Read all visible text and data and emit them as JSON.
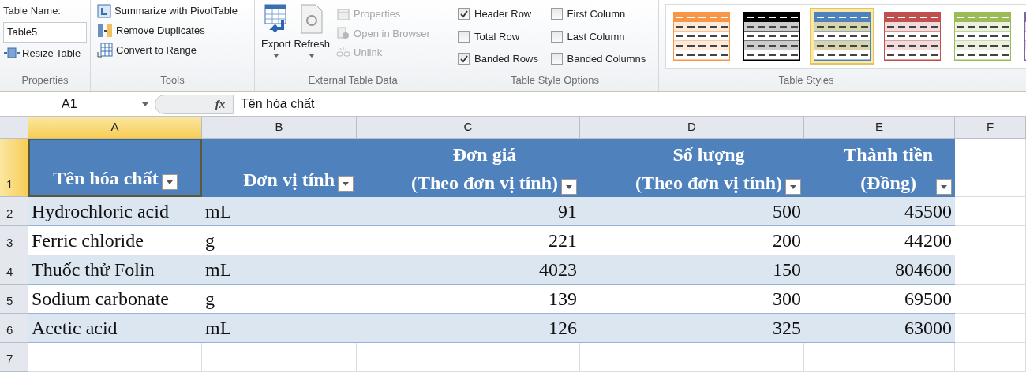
{
  "ribbon": {
    "groups": [
      {
        "kind": "properties",
        "label": "Properties",
        "table_name_label": "Table Name:",
        "table_name": "Table5",
        "resize": "Resize Table"
      },
      {
        "kind": "tools",
        "label": "Tools",
        "items": [
          {
            "label": "Summarize with PivotTable"
          },
          {
            "label": "Remove Duplicates"
          },
          {
            "label": "Convert to Range"
          }
        ]
      },
      {
        "kind": "external",
        "label": "External Table Data",
        "large": [
          {
            "label": "Export",
            "disabled": false
          },
          {
            "label": "Refresh",
            "disabled": false
          }
        ],
        "small": [
          {
            "label": "Properties",
            "disabled": true
          },
          {
            "label": "Open in Browser",
            "disabled": true
          },
          {
            "label": "Unlink",
            "disabled": true
          }
        ]
      },
      {
        "kind": "options",
        "label": "Table Style Options",
        "options": [
          {
            "label": "Header Row",
            "checked": true
          },
          {
            "label": "Total Row",
            "checked": false
          },
          {
            "label": "Banded Rows",
            "checked": true
          },
          {
            "label": "First Column",
            "checked": false
          },
          {
            "label": "Last Column",
            "checked": false
          },
          {
            "label": "Banded Columns",
            "checked": false
          }
        ]
      },
      {
        "kind": "styles",
        "label": "Table Styles",
        "styles": [
          {
            "color": "#f79646",
            "selected": false
          },
          {
            "color": "#000000",
            "selected": false
          },
          {
            "color": "#4f81bd",
            "selected": true
          },
          {
            "color": "#c0504d",
            "selected": false
          },
          {
            "color": "#9bbb59",
            "selected": false
          },
          {
            "color": "#8064a2",
            "selected": false
          }
        ]
      }
    ]
  },
  "formula_bar": {
    "name_box": "A1",
    "fx": "fx",
    "formula": "Tên hóa chất"
  },
  "sheet": {
    "columns": [
      {
        "label": "A",
        "selected": true
      },
      {
        "label": "B",
        "selected": false
      },
      {
        "label": "C",
        "selected": false
      },
      {
        "label": "D",
        "selected": false
      },
      {
        "label": "E",
        "selected": false
      },
      {
        "label": "F",
        "selected": false
      }
    ],
    "row_numbers": [
      {
        "label": "1",
        "selected": true
      },
      {
        "label": "2",
        "selected": false
      },
      {
        "label": "3",
        "selected": false
      },
      {
        "label": "4",
        "selected": false
      },
      {
        "label": "5",
        "selected": false
      },
      {
        "label": "6",
        "selected": false
      },
      {
        "label": "7",
        "selected": false
      }
    ],
    "header": [
      [
        "Tên hóa chất"
      ],
      [
        "Đơn vị tính"
      ],
      [
        "Đơn giá",
        "(Theo đơn vị tính)"
      ],
      [
        "Số lượng",
        "(Theo đơn vị tính)"
      ],
      [
        "Thành tiền",
        "(Đồng)"
      ]
    ],
    "rows": [
      [
        "Hydrochloric acid",
        "mL",
        "91",
        "500",
        "45500"
      ],
      [
        "Ferric chloride",
        "g",
        "221",
        "200",
        "44200"
      ],
      [
        "Thuốc thử Folin",
        "mL",
        "4023",
        "150",
        "804600"
      ],
      [
        "Sodium carbonate",
        "g",
        "139",
        "300",
        "69500"
      ],
      [
        "Acetic acid",
        "mL",
        "126",
        "325",
        "63000"
      ]
    ]
  }
}
